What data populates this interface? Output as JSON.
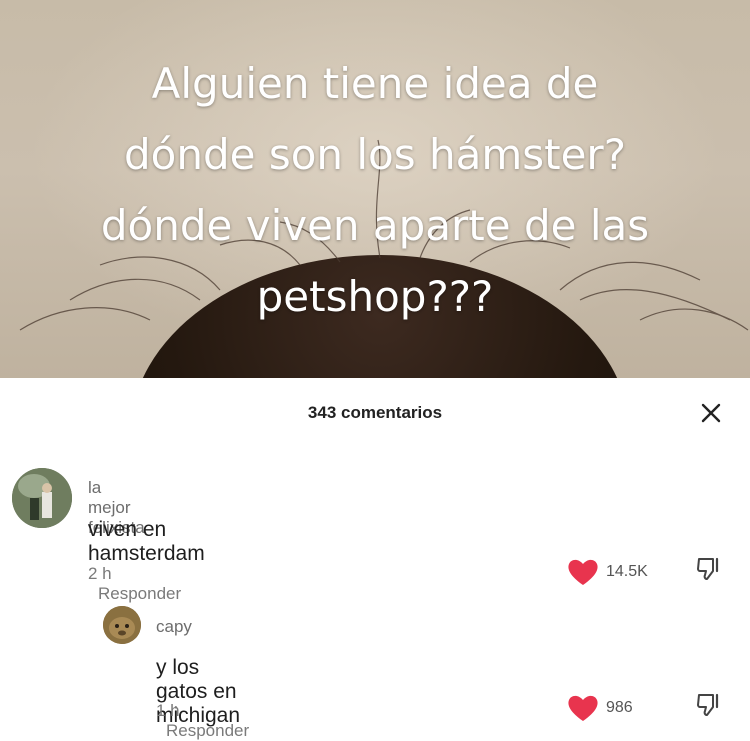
{
  "video": {
    "caption_lines": [
      "Alguien tiene idea de",
      "dónde son los hámster?",
      "dónde viven aparte de las",
      "petshop???"
    ]
  },
  "comments_panel": {
    "title": "343 comentarios",
    "close_icon": "close-icon"
  },
  "comments": [
    {
      "username": "la mejor felixista",
      "text": "viven en hamsterdam",
      "time": "2 h",
      "reply_label": "Responder",
      "likes": "14.5K"
    },
    {
      "username": "capy",
      "text": "y los gatos en michigan",
      "time": "1 h",
      "reply_label": "Responder",
      "likes": "986"
    }
  ],
  "colors": {
    "like_heart": "#e8344e",
    "text_primary": "#1e1e1e",
    "text_secondary": "#7a7a7a"
  }
}
